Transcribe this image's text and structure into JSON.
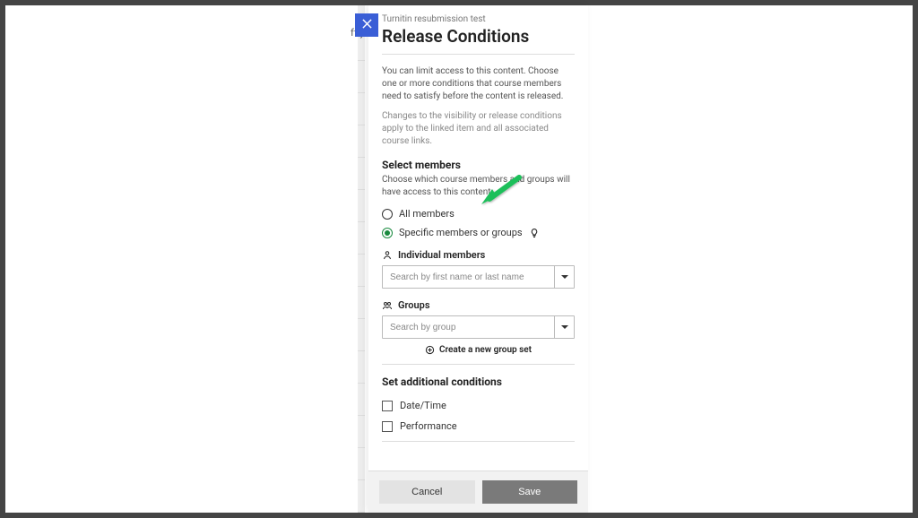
{
  "bg_hint": "ff y",
  "panel": {
    "breadcrumb": "Turnitin resubmission test",
    "title": "Release Conditions",
    "desc1": "You can limit access to this content. Choose one or more conditions that course members need to satisfy before the content is released.",
    "desc2": "Changes to the visibility or release conditions apply to the linked item and all associated course links."
  },
  "members": {
    "heading": "Select members",
    "sub": "Choose which course members and groups will have access to this content",
    "radio_all": "All members",
    "radio_specific": "Specific members or groups"
  },
  "individual": {
    "label": "Individual members",
    "placeholder": "Search by first name or last name"
  },
  "groups": {
    "label": "Groups",
    "placeholder": "Search by group",
    "create_link": "Create a new group set"
  },
  "additional": {
    "heading": "Set additional conditions",
    "datetime": "Date/Time",
    "performance": "Performance"
  },
  "footer": {
    "cancel": "Cancel",
    "save": "Save"
  }
}
